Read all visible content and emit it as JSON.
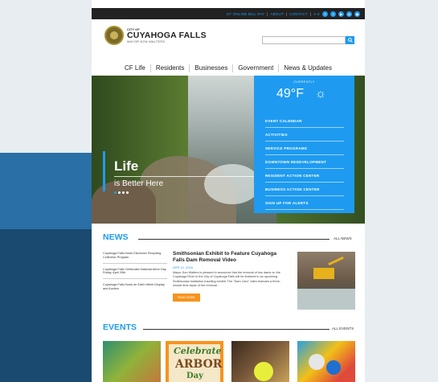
{
  "topbar": {
    "links": [
      "CF ONLINE BILL PAY",
      "ABOUT",
      "CONTACT",
      "A-Z"
    ],
    "separator": "|",
    "social_icons": [
      "facebook-icon",
      "twitter-icon",
      "youtube-icon",
      "email-icon",
      "rss-icon"
    ]
  },
  "header": {
    "city_of": "CITY OF",
    "city_name": "CUYAHOGA FALLS",
    "mayor": "MAYOR DON WALTERS",
    "search_placeholder": "",
    "search_icon": "search-icon"
  },
  "nav": {
    "items": [
      "CF Life",
      "Residents",
      "Businesses",
      "Government",
      "News & Updates"
    ]
  },
  "hero": {
    "title": "Life",
    "subtitle": "is Better Here",
    "slides": 4,
    "active_slide": 0
  },
  "weather": {
    "label": "CURRENTLY",
    "temperature": "49°F",
    "icon": "sun-icon",
    "icon_glyph": "☼"
  },
  "panel": {
    "items": [
      "EVENT CALENDAR",
      "ACTIVITIES",
      "SERVICE PROGRAMS",
      "DOWNTOWN REDEVELOPMENT",
      "RESIDENT ACTION CENTER",
      "BUSINESS ACTION CENTER",
      "SIGN UP FOR ALERTS"
    ]
  },
  "news": {
    "heading": "NEWS",
    "all_label": "ALL NEWS",
    "sidebar_items": [
      "Cuyahoga Falls Hosts Electronic Recycling Collection Program",
      "Cuyahoga Falls Celebrates National Arbor Day Friday, April 29th",
      "Cuyahoga Falls Hosts an Earth Week Display and Auction"
    ],
    "featured": {
      "title": "Smithsonian Exhibit to Feature Cuyahoga Falls Dam Removal Video",
      "date": "APR 13, 2016",
      "body": "Mayor Don Walters is pleased to announce that the removal of two dams on the Cuyahoga River in the City of Cuyahoga Falls will be featured in an upcoming Smithsonian Institution traveling exhibit. The \"Dam Cam\" video features a three-minute time lapse of the removal...",
      "button": "READ MORE"
    }
  },
  "events": {
    "heading": "EVENTS",
    "all_label": "ALL EVENTS",
    "arbor": {
      "line1": "Celebrate",
      "line2": "ARBOR",
      "line3": "Day"
    }
  },
  "colors": {
    "accent": "#1e9bf0",
    "orange": "#f7941d",
    "dark": "#222222"
  }
}
